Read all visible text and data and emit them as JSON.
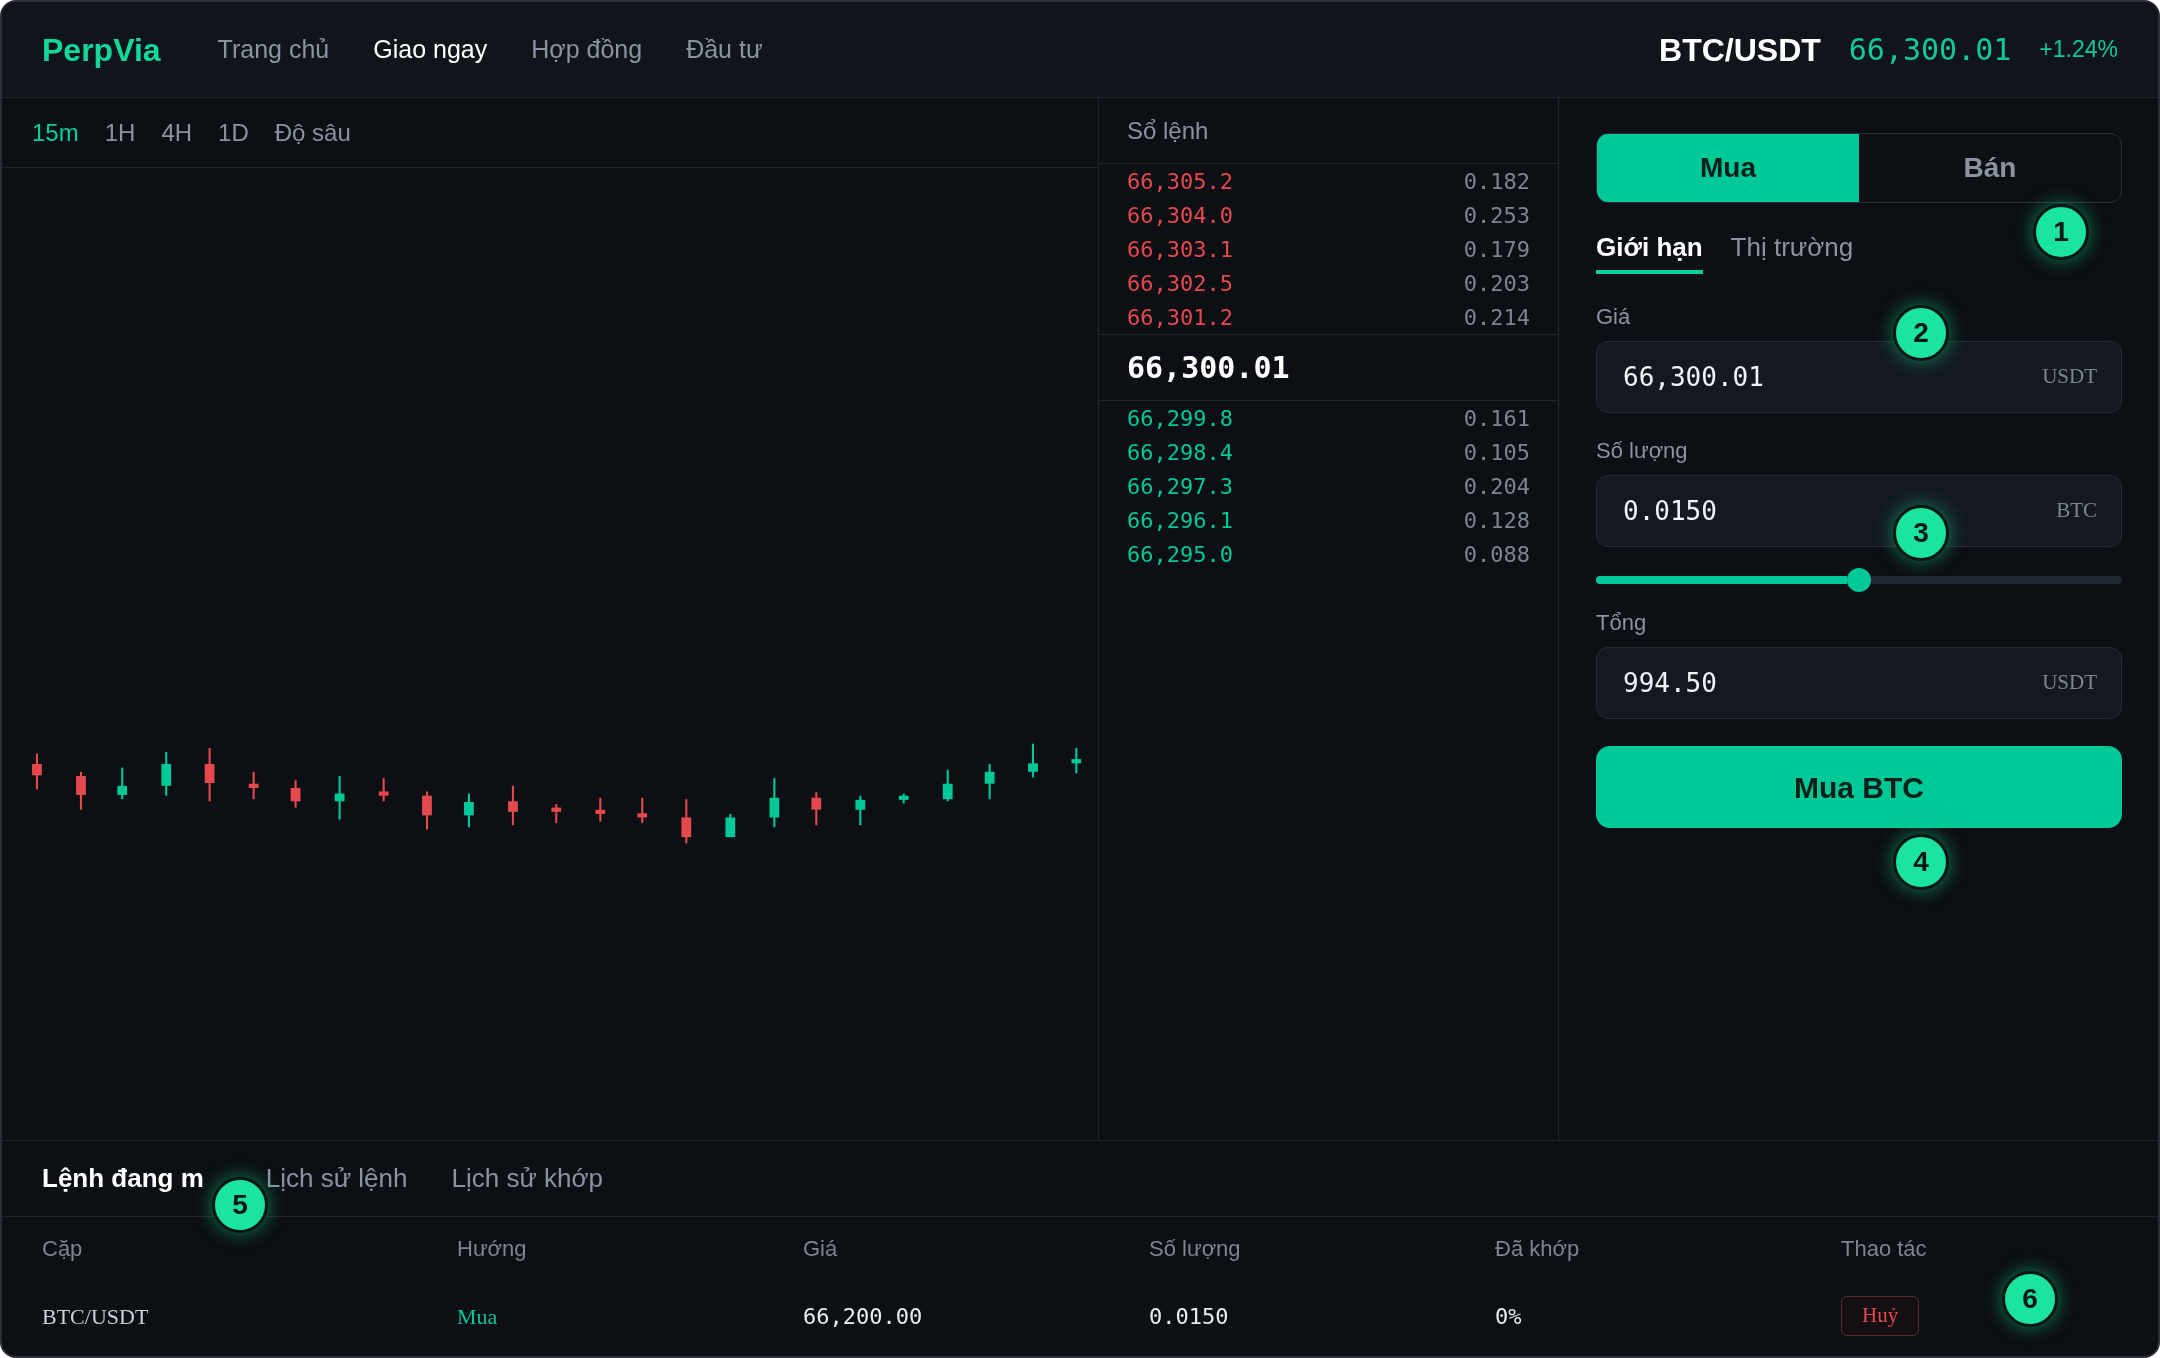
{
  "header": {
    "logo": "PerpVia",
    "nav": [
      {
        "label": "Trang chủ",
        "selected": false
      },
      {
        "label": "Giao ngay",
        "selected": true
      },
      {
        "label": "Hợp đồng",
        "selected": false
      },
      {
        "label": "Đầu tư",
        "selected": false
      }
    ],
    "pair": "BTC/USDT",
    "price": "66,300.01",
    "change": "+1.24%"
  },
  "chart": {
    "timeframes": [
      {
        "label": "15m",
        "selected": true
      },
      {
        "label": "1H",
        "selected": false
      },
      {
        "label": "4H",
        "selected": false
      },
      {
        "label": "1D",
        "selected": false
      },
      {
        "label": "Độ sâu",
        "selected": false
      }
    ]
  },
  "order_book": {
    "title": "Sổ lệnh",
    "asks": [
      {
        "price": "66,305.2",
        "amount": "0.182"
      },
      {
        "price": "66,304.0",
        "amount": "0.253"
      },
      {
        "price": "66,303.1",
        "amount": "0.179"
      },
      {
        "price": "66,302.5",
        "amount": "0.203"
      },
      {
        "price": "66,301.2",
        "amount": "0.214"
      }
    ],
    "last_price": "66,300.01",
    "bids": [
      {
        "price": "66,299.8",
        "amount": "0.161"
      },
      {
        "price": "66,298.4",
        "amount": "0.105"
      },
      {
        "price": "66,297.3",
        "amount": "0.204"
      },
      {
        "price": "66,296.1",
        "amount": "0.128"
      },
      {
        "price": "66,295.0",
        "amount": "0.088"
      }
    ]
  },
  "order_form": {
    "sides": [
      {
        "label": "Mua",
        "selected": true
      },
      {
        "label": "Bán",
        "selected": false
      }
    ],
    "order_types": [
      {
        "label": "Giới hạn",
        "selected": true
      },
      {
        "label": "Thị trường",
        "selected": false
      }
    ],
    "fields": [
      {
        "kind": "input",
        "label": "Giá",
        "value": "66,300.01",
        "unit": "USDT"
      },
      {
        "kind": "input",
        "label": "Số lượng",
        "value": "0.0150",
        "unit": "BTC"
      },
      {
        "kind": "slider",
        "level": 0.5
      },
      {
        "kind": "input",
        "label": "Tổng",
        "value": "994.50",
        "unit": "USDT"
      }
    ],
    "submit": "Mua BTC"
  },
  "orders": {
    "tabs": [
      {
        "label": "Lệnh đang m",
        "selected": true
      },
      {
        "label": "Lịch sử lệnh",
        "selected": false
      },
      {
        "label": "Lịch sử khớp",
        "selected": false
      }
    ],
    "columns": [
      "Cặp",
      "Hướng",
      "Giá",
      "Số lượng",
      "Đã khớp",
      "Thao tác"
    ],
    "rows": [
      {
        "pair": "BTC/USDT",
        "side": {
          "label": "Mua",
          "kind": "buy"
        },
        "price": "66,200.00",
        "amount": "0.0150",
        "filled": "0%",
        "action": "Huỷ"
      }
    ]
  },
  "annotations": [
    {
      "label": "1"
    },
    {
      "label": "2"
    },
    {
      "label": "3"
    },
    {
      "label": "4"
    },
    {
      "label": "5"
    },
    {
      "label": "6"
    }
  ]
}
